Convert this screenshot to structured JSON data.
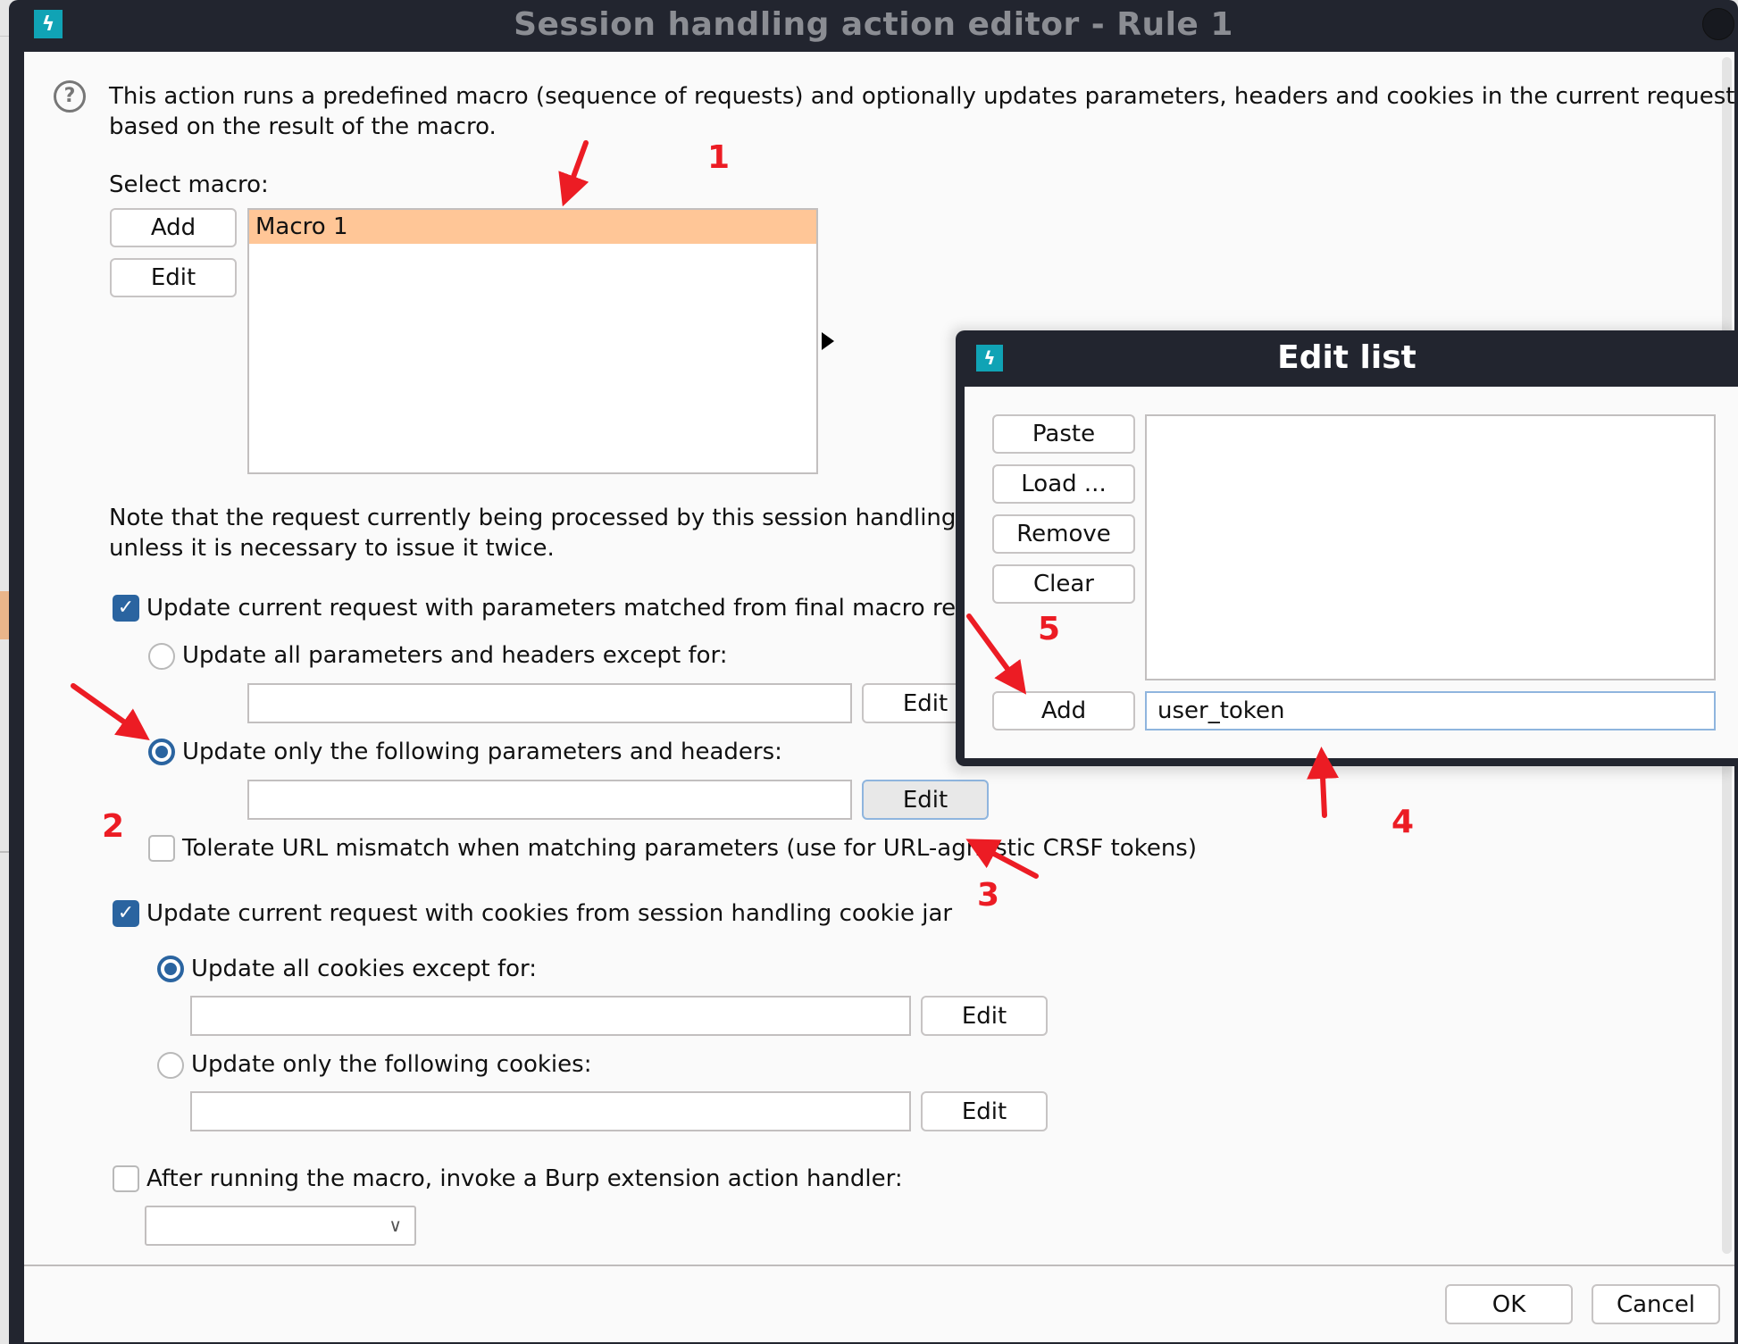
{
  "window": {
    "title": "Session handling action editor - Rule 1",
    "app_icon": "burp-lightning-icon",
    "close_icon": "close-circle-icon"
  },
  "description": {
    "icon": "help-icon",
    "line1": "This action runs a predefined macro (sequence of requests) and optionally updates parameters, headers and cookies in the current request",
    "line2": "based on the result of the macro."
  },
  "macro": {
    "label": "Select macro:",
    "add_label": "Add",
    "edit_label": "Edit",
    "items": [
      {
        "name": "Macro 1",
        "selected": true
      }
    ]
  },
  "note": {
    "line1": "Note that the request currently being processed by this session handling rule",
    "line2": "unless it is necessary to issue it twice."
  },
  "params": {
    "update_checkbox_label": "Update current request with parameters matched from final macro respo",
    "update_checked": true,
    "all_except_label": "Update all parameters and headers except for:",
    "all_except_selected": false,
    "all_except_value": "",
    "all_except_edit": "Edit",
    "only_following_label": "Update only the following parameters and headers:",
    "only_following_selected": true,
    "only_following_value": "",
    "only_following_edit": "Edit",
    "tolerate_label": "Tolerate URL mismatch when matching parameters (use for URL-agnostic CRSF tokens)",
    "tolerate_checked": false
  },
  "cookies": {
    "update_checkbox_label": "Update current request with cookies from session handling cookie jar",
    "update_checked": true,
    "all_except_label": "Update all cookies except for:",
    "all_except_selected": true,
    "all_except_value": "",
    "all_except_edit": "Edit",
    "only_following_label": "Update only the following cookies:",
    "only_following_selected": false,
    "only_following_value": "",
    "only_following_edit": "Edit"
  },
  "extension": {
    "checkbox_label": "After running the macro, invoke a Burp extension action handler:",
    "checked": false,
    "selected_value": ""
  },
  "footer": {
    "ok_label": "OK",
    "cancel_label": "Cancel"
  },
  "edit_list_dialog": {
    "title": "Edit list",
    "paste_label": "Paste",
    "load_label": "Load ...",
    "remove_label": "Remove",
    "clear_label": "Clear",
    "add_label": "Add",
    "items": [],
    "input_value": "user_token"
  },
  "annotations": {
    "color": "#ec1c24",
    "labels": [
      "1",
      "2",
      "3",
      "4",
      "5"
    ]
  }
}
